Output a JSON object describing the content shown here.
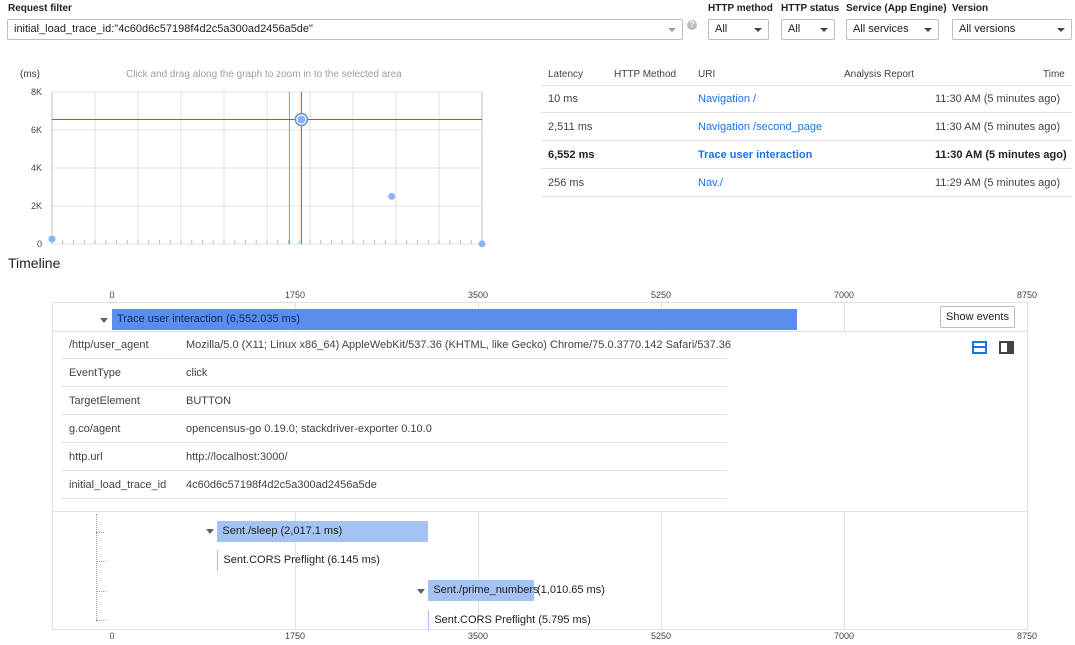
{
  "filters": {
    "request_filter_label": "Request filter",
    "request_filter_value": "initial_load_trace_id:\"4c60d6c57198f4d2c5a300ad2456a5de\"",
    "help_icon": "?",
    "http_method_label": "HTTP method",
    "http_method_value": "All",
    "http_status_label": "HTTP status",
    "http_status_value": "All",
    "service_label": "Service (App Engine)",
    "service_value": "All services",
    "version_label": "Version",
    "version_value": "All versions"
  },
  "scatter": {
    "unit_label": "(ms)",
    "hint": "Click and drag along the graph to zoom in to the selected area",
    "y_ticks": [
      "8K",
      "6K",
      "4K",
      "2K",
      "0"
    ]
  },
  "chart_data": {
    "type": "scatter",
    "title": "",
    "xlabel": "",
    "ylabel": "(ms)",
    "ylim": [
      0,
      8000
    ],
    "y_ticks": [
      "8K",
      "6K",
      "4K",
      "2K",
      "0"
    ],
    "points": [
      {
        "x": 0.0,
        "y": 256
      },
      {
        "x": 0.58,
        "y": 6552,
        "selected": true
      },
      {
        "x": 0.79,
        "y": 2511
      },
      {
        "x": 1.0,
        "y": 10
      }
    ],
    "crosshair_y": 6552,
    "grid": true
  },
  "requests": {
    "headers": {
      "latency": "Latency",
      "method": "HTTP Method",
      "uri": "URI",
      "analysis": "Analysis Report",
      "time": "Time"
    },
    "rows": [
      {
        "latency": "10 ms",
        "method": "",
        "uri": "Navigation /",
        "time": "11:30 AM  (5 minutes ago)"
      },
      {
        "latency": "2,511 ms",
        "method": "",
        "uri": "Navigation /second_page",
        "time": "11:30 AM  (5 minutes ago)"
      },
      {
        "latency": "6,552 ms",
        "method": "",
        "uri": "Trace user interaction",
        "time": "11:30 AM  (5 minutes ago)"
      },
      {
        "latency": "256 ms",
        "method": "",
        "uri": "Nav./",
        "time": "11:29 AM  (5 minutes ago)"
      }
    ]
  },
  "timeline": {
    "title": "Timeline",
    "axis_ticks": [
      "0",
      "1750",
      "3500",
      "5250",
      "7000",
      "8750"
    ],
    "axis_max": 8750,
    "show_events_label": "Show events",
    "spans": [
      {
        "label": "Trace user interaction (6,552.035 ms)",
        "start": 0,
        "duration": 6552.035,
        "color": "#5b8def"
      },
      {
        "label": "Sent./sleep (2,017.1 ms)",
        "start": 1008,
        "duration": 2017.1,
        "color": "#a4c2f4"
      },
      {
        "label": "Sent.CORS Preflight (6.145 ms)",
        "start": 1008,
        "duration": 6.145,
        "color": "#a4c2f4"
      },
      {
        "label": "Sent./prime_numbers",
        "extra": "(1,010.65 ms)",
        "start": 3025,
        "duration": 1010.65,
        "color": "#a4c2f4"
      },
      {
        "label": "Sent.CORS Preflight (5.795 ms)",
        "start": 3025,
        "duration": 5.795,
        "color": "#a4c2f4"
      }
    ],
    "attributes": [
      {
        "key": "/http/user_agent",
        "value": "Mozilla/5.0 (X11; Linux x86_64) AppleWebKit/537.36 (KHTML, like Gecko) Chrome/75.0.3770.142 Safari/537.36"
      },
      {
        "key": "EventType",
        "value": "click"
      },
      {
        "key": "TargetElement",
        "value": "BUTTON"
      },
      {
        "key": "g.co/agent",
        "value": "opencensus-go 0.19.0; stackdriver-exporter 0.10.0"
      },
      {
        "key": "http.url",
        "value": "http://localhost:3000/"
      },
      {
        "key": "initial_load_trace_id",
        "value": "4c60d6c57198f4d2c5a300ad2456a5de"
      }
    ]
  },
  "colors": {
    "accent": "#1a73e8",
    "crosshair": "#e53935",
    "point": "#8ab4f8",
    "span_main": "#5b8def",
    "span_child": "#a4c2f4"
  }
}
